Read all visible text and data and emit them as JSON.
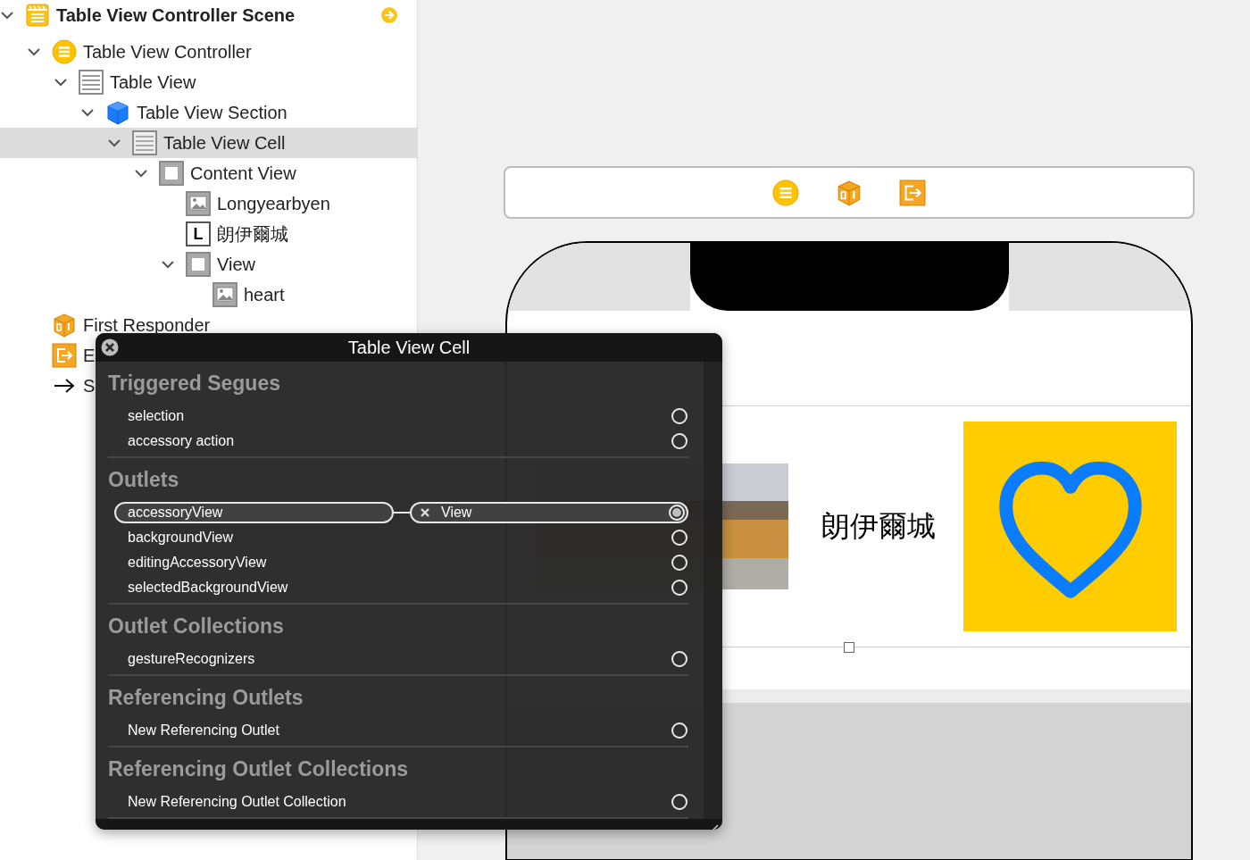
{
  "outline": [
    {
      "kind": "scene",
      "label": "Table View Controller Scene",
      "expanded": true,
      "selected": false,
      "children": [
        {
          "kind": "controller",
          "label": "Table View Controller",
          "expanded": true,
          "selected": false,
          "children": [
            {
              "kind": "table",
              "label": "Table View",
              "expanded": true,
              "selected": false,
              "children": [
                {
                  "kind": "section",
                  "label": "Table View Section",
                  "expanded": true,
                  "selected": false,
                  "children": [
                    {
                      "kind": "cell",
                      "label": "Table View Cell",
                      "expanded": true,
                      "selected": true,
                      "children": [
                        {
                          "kind": "view",
                          "label": "Content View",
                          "expanded": true,
                          "selected": false,
                          "children": [
                            {
                              "kind": "image",
                              "label": "Longyearbyen",
                              "selected": false
                            },
                            {
                              "kind": "label",
                              "badge": "L",
                              "label": "朗伊爾城",
                              "selected": false
                            },
                            {
                              "kind": "view",
                              "label": "View",
                              "expanded": true,
                              "selected": false,
                              "children": [
                                {
                                  "kind": "image",
                                  "label": "heart",
                                  "selected": false
                                }
                              ]
                            }
                          ]
                        }
                      ]
                    }
                  ]
                }
              ]
            }
          ]
        },
        {
          "kind": "responder",
          "label": "First Responder",
          "selected": false
        },
        {
          "kind": "exit",
          "label": "E",
          "selected": false
        },
        {
          "kind": "entry",
          "label": "S",
          "selected": false
        }
      ]
    }
  ],
  "cell": {
    "title": "朗伊爾城"
  },
  "popover": {
    "title": "Table View Cell",
    "sections": [
      {
        "title": "Triggered Segues",
        "rows": [
          {
            "label": "selection",
            "connected": false
          },
          {
            "label": "accessory action",
            "connected": false
          }
        ]
      },
      {
        "title": "Outlets",
        "rows": [
          {
            "label": "accessoryView",
            "connected": true,
            "target": "View"
          },
          {
            "label": "backgroundView",
            "connected": false
          },
          {
            "label": "editingAccessoryView",
            "connected": false
          },
          {
            "label": "selectedBackgroundView",
            "connected": false
          }
        ]
      },
      {
        "title": "Outlet Collections",
        "rows": [
          {
            "label": "gestureRecognizers",
            "connected": false
          }
        ]
      },
      {
        "title": "Referencing Outlets",
        "rows": [
          {
            "label": "New Referencing Outlet",
            "connected": false
          }
        ]
      },
      {
        "title": "Referencing Outlet Collections",
        "rows": [
          {
            "label": "New Referencing Outlet Collection",
            "connected": false
          }
        ]
      }
    ]
  }
}
